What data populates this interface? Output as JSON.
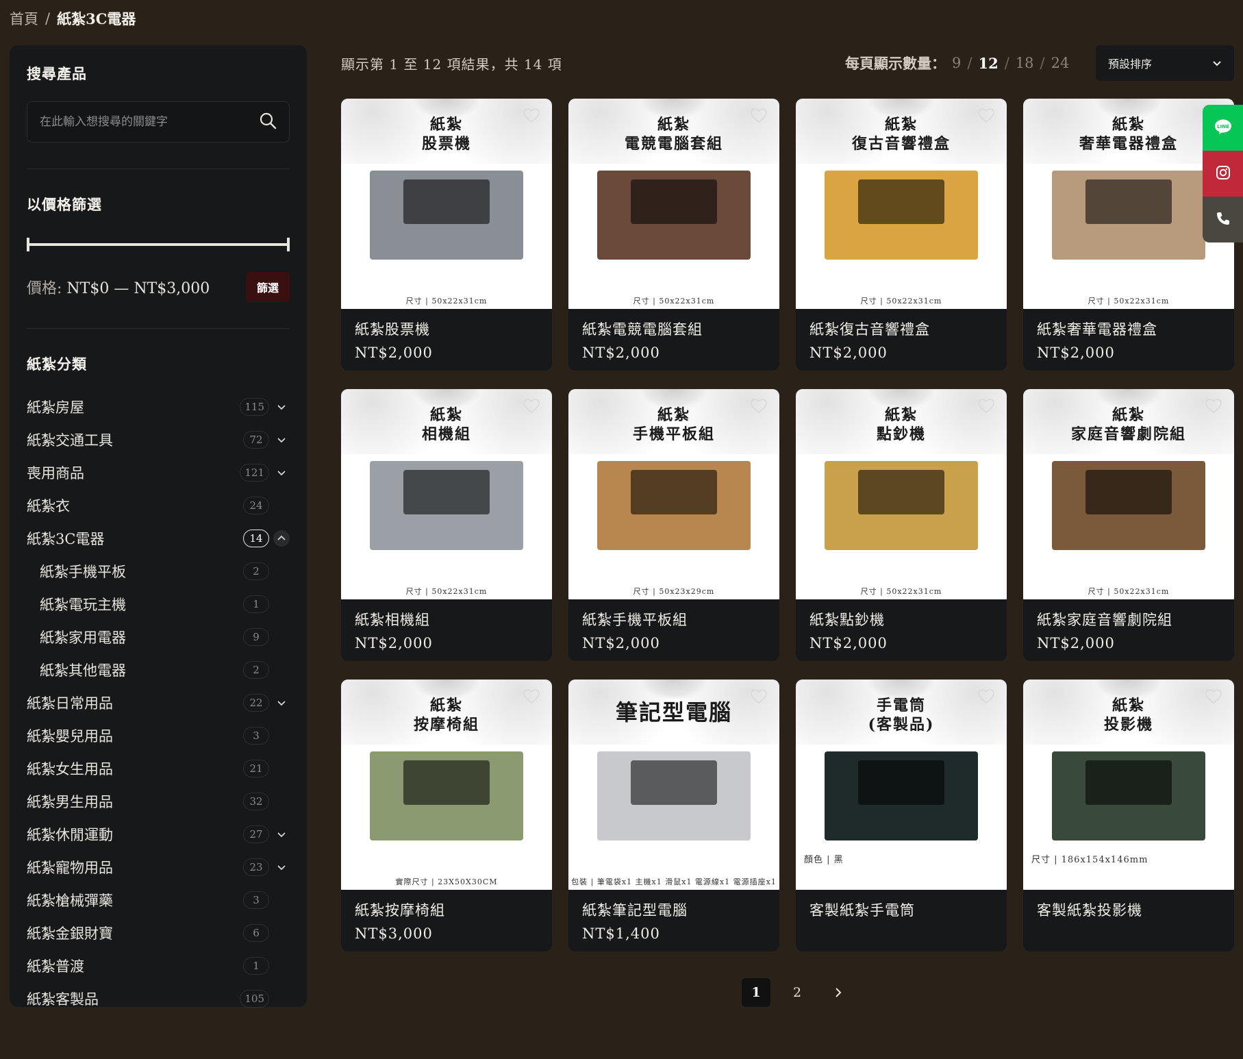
{
  "breadcrumb": {
    "home": "首頁",
    "separator": "/",
    "current": "紙紮3C電器"
  },
  "sidebar": {
    "search_title": "搜尋產品",
    "search_placeholder": "在此輸入想搜尋的關鍵字",
    "price_title": "以價格篩選",
    "price_label": "價格:",
    "price_range": "NT$0 — NT$3,000",
    "filter_button": "篩選",
    "category_title": "紙紮分類",
    "categories": [
      {
        "label": "紙紮房屋",
        "count": "115",
        "chevron": "down"
      },
      {
        "label": "紙紮交通工具",
        "count": "72",
        "chevron": "down"
      },
      {
        "label": "喪用商品",
        "count": "121",
        "chevron": "down"
      },
      {
        "label": "紙紮衣",
        "count": "24",
        "chevron": "none"
      },
      {
        "label": "紙紮3C電器",
        "count": "14",
        "chevron": "up",
        "active": true
      },
      {
        "label": "紙紮手機平板",
        "count": "2",
        "chevron": "none",
        "sub": true
      },
      {
        "label": "紙紮電玩主機",
        "count": "1",
        "chevron": "none",
        "sub": true
      },
      {
        "label": "紙紮家用電器",
        "count": "9",
        "chevron": "none",
        "sub": true
      },
      {
        "label": "紙紮其他電器",
        "count": "2",
        "chevron": "none",
        "sub": true
      },
      {
        "label": "紙紮日常用品",
        "count": "22",
        "chevron": "down"
      },
      {
        "label": "紙紮嬰兒用品",
        "count": "3",
        "chevron": "none"
      },
      {
        "label": "紙紮女生用品",
        "count": "21",
        "chevron": "none"
      },
      {
        "label": "紙紮男生用品",
        "count": "32",
        "chevron": "none"
      },
      {
        "label": "紙紮休閒運動",
        "count": "27",
        "chevron": "down"
      },
      {
        "label": "紙紮寵物用品",
        "count": "23",
        "chevron": "down"
      },
      {
        "label": "紙紮槍械彈藥",
        "count": "3",
        "chevron": "none"
      },
      {
        "label": "紙紮金銀財寶",
        "count": "6",
        "chevron": "none"
      },
      {
        "label": "紙紮普渡",
        "count": "1",
        "chevron": "none"
      },
      {
        "label": "紙紮客製品",
        "count": "105",
        "chevron": "none"
      }
    ]
  },
  "toolbar": {
    "result_count": "顯示第 1 至 12 項結果，共 14 項",
    "per_page_label": "每頁顯示數量：",
    "per_page_options": [
      "9",
      "12",
      "18",
      "24"
    ],
    "per_page_active": "12",
    "sort_label": "預設排序"
  },
  "products": [
    {
      "img_title": "紙紮\n股票機",
      "caption": "尺寸 | 50x22x31cm",
      "name": "紙紮股票機",
      "price": "NT$2,000",
      "color": "#8a8f96"
    },
    {
      "img_title": "紙紮\n電競電腦套組",
      "caption": "尺寸 | 50x22x31cm",
      "name": "紙紮電競電腦套組",
      "price": "NT$2,000",
      "color": "#6b4a3a"
    },
    {
      "img_title": "紙紮\n復古音響禮盒",
      "caption": "尺寸 | 50x22x31cm",
      "name": "紙紮復古音響禮盒",
      "price": "NT$2,000",
      "color": "#d9a441"
    },
    {
      "img_title": "紙紮\n奢華電器禮盒",
      "caption": "尺寸 | 50x22x31cm",
      "name": "紙紮奢華電器禮盒",
      "price": "NT$2,000",
      "color": "#b89b7c"
    },
    {
      "img_title": "紙紮\n相機組",
      "caption": "尺寸 | 50x22x31cm",
      "name": "紙紮相機組",
      "price": "NT$2,000",
      "color": "#9aa0a6"
    },
    {
      "img_title": "紙紮\n手機平板組",
      "caption": "尺寸 | 50x23x29cm",
      "name": "紙紮手機平板組",
      "price": "NT$2,000",
      "color": "#b8874f"
    },
    {
      "img_title": "紙紮\n點鈔機",
      "caption": "尺寸 | 50x22x31cm",
      "name": "紙紮點鈔機",
      "price": "NT$2,000",
      "color": "#c9a14a"
    },
    {
      "img_title": "紙紮\n家庭音響劇院組",
      "caption": "尺寸 | 50x22x31cm",
      "name": "紙紮家庭音響劇院組",
      "price": "NT$2,000",
      "color": "#7a5a3a"
    },
    {
      "img_title": "紙紮\n按摩椅組",
      "caption": "實際尺寸 | 23X50X30CM",
      "name": "紙紮按摩椅組",
      "price": "NT$3,000",
      "color": "#8c9a72"
    },
    {
      "img_title": "筆記型電腦",
      "caption": "包裝 | 筆電袋x1 主機x1 滑鼠x1 電源線x1 電源插座x1",
      "name": "紙紮筆記型電腦",
      "price": "NT$1,400",
      "color": "#c7c9cc",
      "big": true
    },
    {
      "img_title": "手電筒\n(客製品)",
      "caption": "顏色 | 黑",
      "name": "客製紙紮手電筒",
      "price": "",
      "color": "#1f2a2a",
      "caption_left": true
    },
    {
      "img_title": "紙紮\n投影機",
      "caption": "尺寸 | 186x154x146mm",
      "name": "客製紙紮投影機",
      "price": "",
      "color": "#3a4a3a",
      "caption_left": true
    }
  ],
  "pagination": {
    "pages": [
      "1",
      "2"
    ],
    "active": "1"
  },
  "float_buttons": [
    {
      "icon": "line-icon",
      "color": "#06c755"
    },
    {
      "icon": "instagram-icon",
      "color": "#c1283a"
    },
    {
      "icon": "phone-icon",
      "color": "#4a4640"
    }
  ]
}
